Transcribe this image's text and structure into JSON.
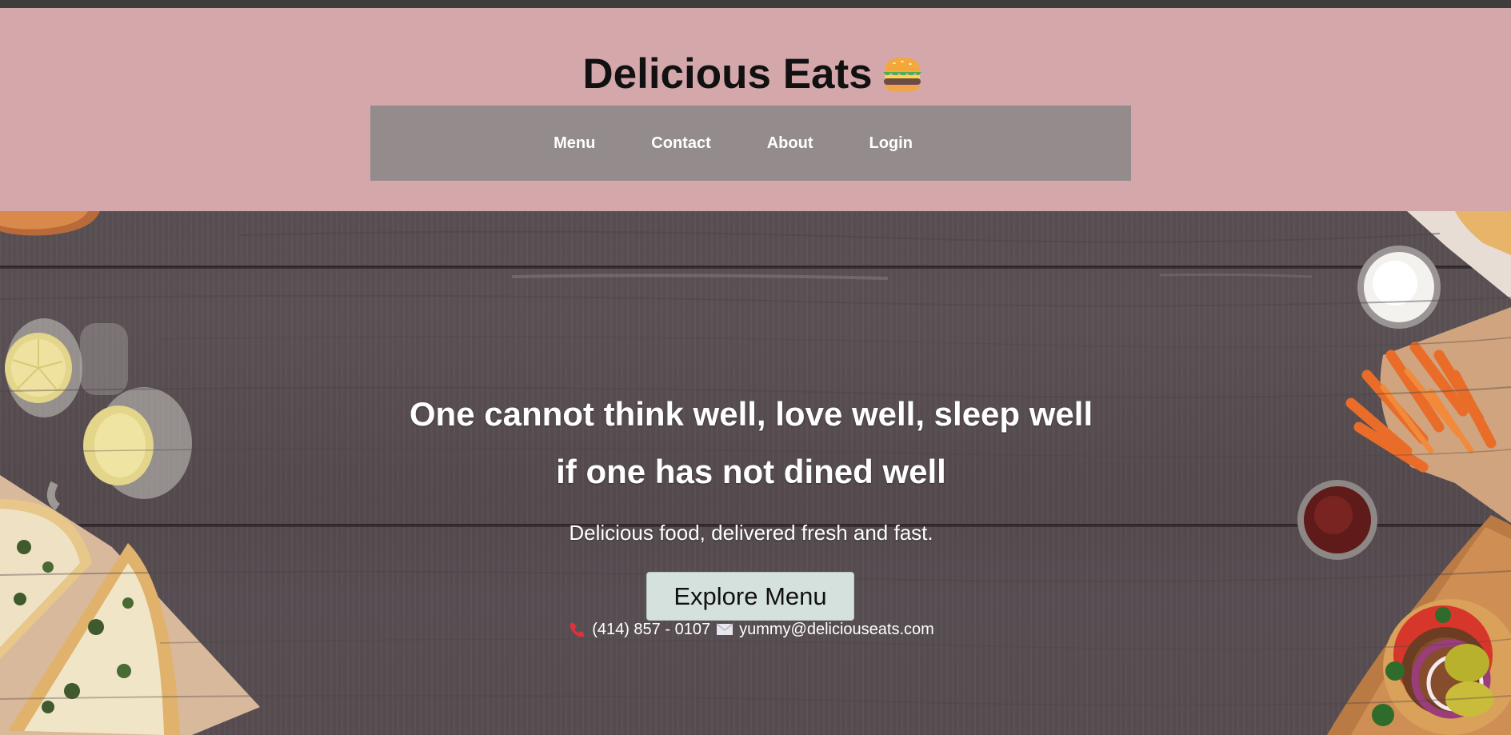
{
  "brand": {
    "title": "Delicious Eats",
    "icon": "hamburger-icon"
  },
  "nav": {
    "items": [
      {
        "label": "Menu"
      },
      {
        "label": "Contact"
      },
      {
        "label": "About"
      },
      {
        "label": "Login"
      }
    ]
  },
  "hero": {
    "quote_line1": "One cannot think well, love well, sleep well",
    "quote_line2": "if one has not dined well",
    "tagline": "Delicious food, delivered fresh and fast.",
    "cta_label": "Explore Menu"
  },
  "contact": {
    "phone": "(414) 857 - 0107",
    "email": "yummy@deliciouseats.com",
    "phone_icon": "phone-icon",
    "email_icon": "envelope-icon"
  },
  "colors": {
    "header_bg": "#d4a7ab",
    "nav_bg": "#938b8c",
    "button_bg": "#d5e1dc",
    "phone_icon": "#e0303a"
  }
}
